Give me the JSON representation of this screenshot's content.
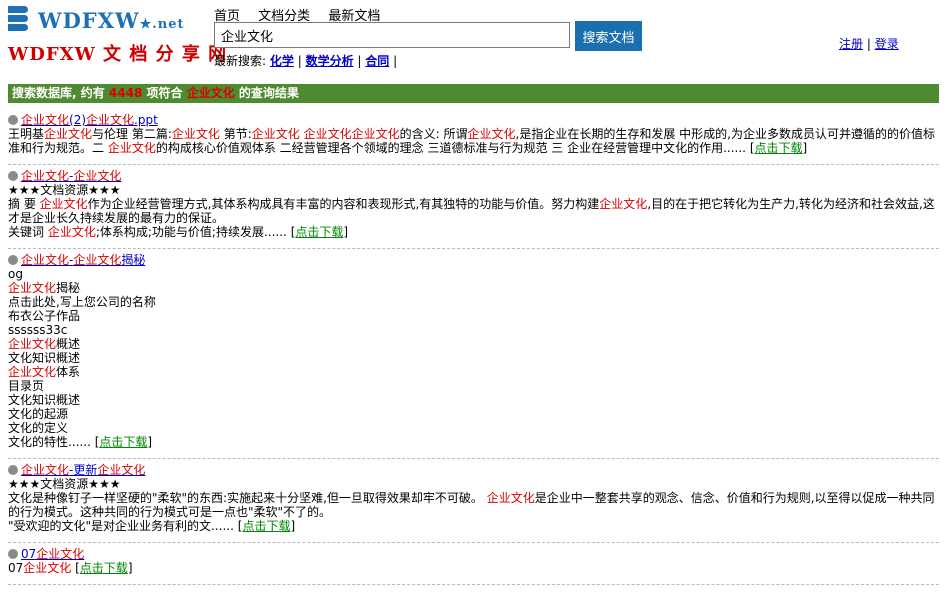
{
  "logo": {
    "en": "WDFXW",
    "net": "net",
    "cn": "WDFXW 文 档 分 享 网"
  },
  "nav": [
    "首页",
    "文档分类",
    "最新文档"
  ],
  "search": {
    "value": "企业文化",
    "button": "搜索文档"
  },
  "recent": {
    "label": "最新搜索:",
    "items": [
      "化学",
      "数学分析",
      "合同"
    ]
  },
  "auth": {
    "register": "注册",
    "login": "登录"
  },
  "result_bar": {
    "prefix": "搜索数据库, 约有 ",
    "count": "4448",
    "mid": " 项符合 ",
    "keyword": "企业文化",
    "suffix": " 的查询结果"
  },
  "results": [
    {
      "title": "企业文化(2)企业文化.ppt",
      "body": "王明基企业文化与伦理 第二篇:企业文化 第节:企业文化 企业文化企业文化的含义: 所谓企业文化,是指企业在长期的生存和发展 中形成的,为企业多数成员认可并遵循的的价值标准和行为规范。二 企业文化的构成核心价值观体系 二经营管理各个领域的理念 三道德标准与行为规范 三 企业在经营管理中文化的作用......",
      "more": "点击下载"
    },
    {
      "title": "企业文化-企业文化",
      "body": "★★★文档资源★★★\n摘 要 企业文化作为企业经营管理方式,其体系构成具有丰富的内容和表现形式,有其独特的功能与价值。努力构建企业文化,目的在于把它转化为生产力,转化为经济和社会效益,这才是企业长久持续发展的最有力的保证。\n关键词 企业文化;体系构成;功能与价值;持续发展......",
      "more": "点击下载"
    },
    {
      "title": "企业文化-企业文化揭秘",
      "body": "og\n企业文化揭秘\n点击此处,写上您公司的名称\n布衣公子作品\nssssss33c\n企业文化概述\n文化知识概述\n企业文化体系\n目录页\n文化知识概述\n文化的起源\n文化的定义\n文化的特性......",
      "more": "点击下载"
    },
    {
      "title": "企业文化-更新企业文化",
      "body": "★★★文档资源★★★\n文化是种像钉子一样坚硬的\"柔软\"的东西:实施起来十分坚难,但一旦取得效果却牢不可破。 企业文化是企业中一整套共享的观念、信念、价值和行为规则,以至得以促成一种共同的行为模式。这种共同的行为模式可是一点也\"柔软\"不了的。\n\"受欢迎的文化\"是对企业业务有利的文......",
      "more": "点击下载"
    },
    {
      "title": "07企业文化",
      "body": "07企业文化",
      "more": "点击下载"
    }
  ]
}
